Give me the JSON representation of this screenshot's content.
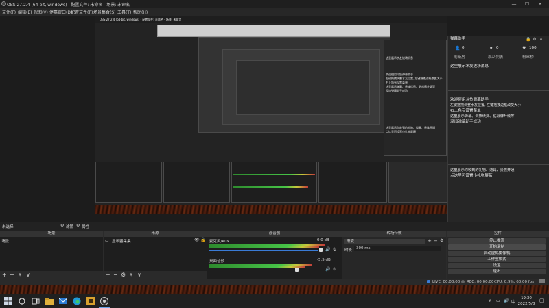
{
  "window": {
    "title": "OBS 27.2.4 (64-bit, windows) - 配置文件: 未命名 - 场景: 未命名",
    "minimize": "—",
    "maximize": "☐",
    "close": "✕"
  },
  "menu": [
    "文件(F)",
    "编辑(E)",
    "视图(V)",
    "停靠窗口(D)",
    "配置文件(P)",
    "场景集合(S)",
    "工具(T)",
    "帮助(H)"
  ],
  "preview": {
    "inner_title": "OBS 27.2.4 (64-bit, windows) - 配置文件: 未命名 - 场景: 未命名",
    "inner_lines": [
      "这里展示水友进场消息",
      "欢迎使用斗鱼弹幕助手",
      "左键拖拽调整水友位置, 左键拖拽边框改变大小",
      "右上角有设置菜单",
      "这里展示弹幕、贵族续费、粘战牌升级等",
      "添加弹幕助手成功",
      "这里展示你收到的礼物、道具、贵族开通",
      "点这里可设置小礼物屏蔽"
    ],
    "side_panel": {
      "title": "弹幕助手",
      "stats": [
        "0",
        "0",
        "100"
      ],
      "tabs": [
        "刷新房",
        "观众列表",
        "粉丝榜"
      ],
      "msg1": "这里展示水友进场消息",
      "msg2": [
        "欢迎使用斗鱼弹幕助手",
        "左键拖拽调整水友位置, 左键拖拽边框改变大小",
        "右上角有设置菜单",
        "这里展示弹幕、贵族续费、粘战牌升级等",
        "添加弹幕助手成功"
      ],
      "msg3": [
        "这里展示你收到的礼物、道具、贵族开通",
        "点这里可设置小礼物屏蔽"
      ]
    }
  },
  "scene_bar": {
    "label": "未选择",
    "filter_btn": "滤镜",
    "attr_btn": "属性"
  },
  "scenes": {
    "header": "场景",
    "items": [
      "场景"
    ]
  },
  "sources": {
    "header": "来源",
    "items": [
      "显示器采集"
    ]
  },
  "mixer": {
    "header": "混音器",
    "channels": [
      {
        "name": "麦克风/Aux",
        "db": "0.0 dB"
      },
      {
        "name": "桌面音频",
        "db": "-5.5 dB"
      }
    ]
  },
  "transitions": {
    "header": "转场特效",
    "type": "渐变",
    "duration_label": "时长",
    "duration": "300 ms"
  },
  "controls": {
    "header": "控件",
    "buttons": [
      "停止推流",
      "开始录制",
      "启动虚拟摄像机",
      "工作室模式",
      "设置",
      "退出"
    ]
  },
  "status": {
    "live": "LIVE: 00:00:00",
    "rec": "REC: 00:00:00",
    "cpu": "CPU: 0.9%, 60.00 fps"
  },
  "taskbar": {
    "time": "19:30",
    "date": "2022/5/8"
  },
  "colors": {
    "accent": "#3a7bd5",
    "bg": "#2b2b2b",
    "dock": "#1e1e1e"
  }
}
